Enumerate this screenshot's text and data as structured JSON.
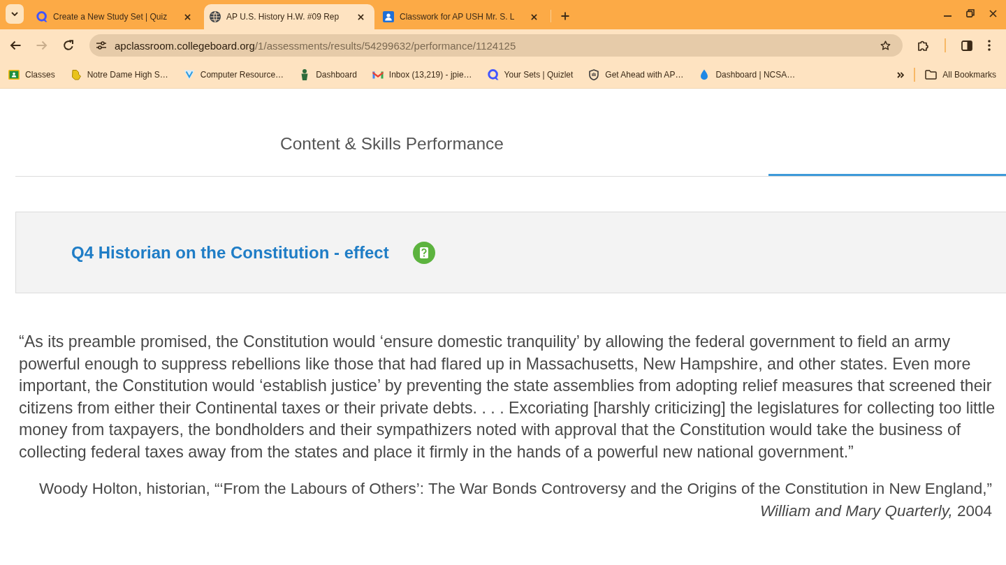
{
  "browser": {
    "tabs": [
      {
        "kind": "quizlet",
        "title": "Create a New Study Set | Quiz",
        "selected": false
      },
      {
        "kind": "globe",
        "title": "AP U.S. History H.W. #09 Rep",
        "selected": true
      },
      {
        "kind": "person-tile",
        "title": "Classwork for AP USH Mr. S. L",
        "selected": false
      }
    ],
    "nav_buttons": [
      {
        "kind": "back",
        "disabled": false
      },
      {
        "kind": "forward",
        "disabled": true
      },
      {
        "kind": "reload",
        "disabled": false
      }
    ],
    "address_bar": {
      "host": "apclassroom.collegeboard.org",
      "path": "/1/assessments/results/54299632/performance/1124125"
    },
    "bookmarks": [
      {
        "kind": "classroom",
        "label": "Classes"
      },
      {
        "kind": "crest",
        "label": "Notre Dame High S…"
      },
      {
        "kind": "v-shield",
        "label": "Computer Resource…"
      },
      {
        "kind": "figure",
        "label": "Dashboard"
      },
      {
        "kind": "gmail",
        "label": "Inbox (13,219) - jpie…"
      },
      {
        "kind": "quizlet",
        "label": "Your Sets | Quizlet"
      },
      {
        "kind": "hand-shield",
        "label": "Get Ahead with AP…"
      },
      {
        "kind": "drop",
        "label": "Dashboard | NCSA…"
      }
    ],
    "all_bookmarks": "All Bookmarks"
  },
  "page_tabs": [
    {
      "label": "Content & Skills Performance",
      "selected": false
    },
    {
      "selected": true
    }
  ],
  "question": {
    "title": "Q4 Historian on the Constitution - effect"
  },
  "passage": {
    "quote": "“As its preamble promised, the Constitution would ‘ensure domestic tranquility’ by allowing the federal government to field an army powerful enough to suppress rebellions like those that had flared up in Massachusetts, New Hampshire, and other states. Even more important, the Constitution would ‘establish justice’ by preventing the state assemblies from adopting relief measures that screened their citizens from either their Continental taxes or their private debts. . . . Excoriating [harshly criticizing] the legislatures for collecting too little money from taxpayers, the bondholders and their sympathizers noted with approval that the Constitution would take the business of collecting federal taxes away from the states and place it firmly in the hands of a powerful new national government.”",
    "citation": "Woody Holton, historian, “‘From the Labours of Others’: The War Bonds Controversy and the Origins of the Constitution in New England,” *William and Mary Quarterly,* 2004"
  }
}
